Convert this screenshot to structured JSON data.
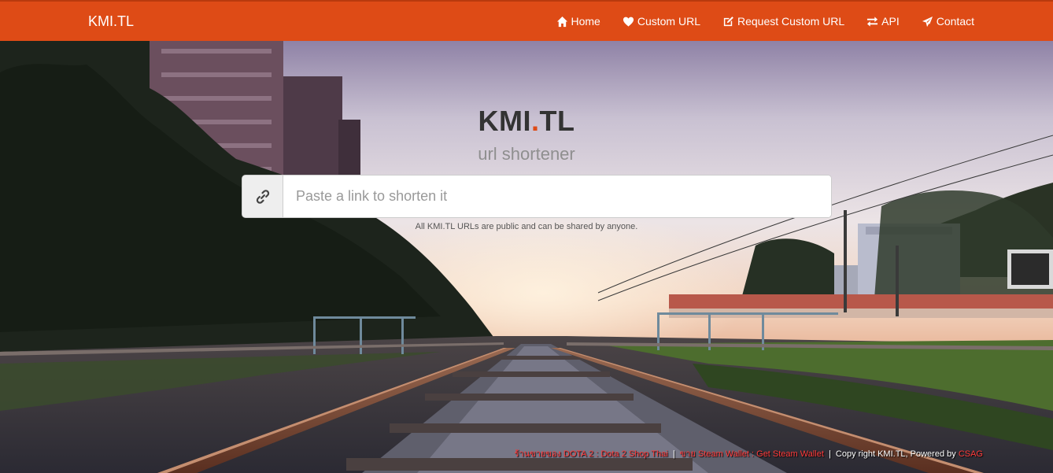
{
  "navbar": {
    "brand": "KMI.TL",
    "items": [
      {
        "label": "Home",
        "icon": "home-icon"
      },
      {
        "label": "Custom URL",
        "icon": "heart-icon"
      },
      {
        "label": "Request Custom URL",
        "icon": "edit-icon"
      },
      {
        "label": "API",
        "icon": "exchange-icon"
      },
      {
        "label": "Contact",
        "icon": "send-icon"
      }
    ]
  },
  "hero": {
    "title_part1": "KMI",
    "title_dot": ".",
    "title_part2": "TL",
    "subtitle": "url shortener",
    "input_placeholder": "Paste a link to shorten it",
    "input_value": "",
    "help_text": "All KMI.TL URLs are public and can be shared by anyone."
  },
  "footer": {
    "link1": "ร้านขายของ DOTA 2 : Dota 2 Shop Thai",
    "sep1": "|",
    "link2": "ขาย Steam Wallet : Get Steam Wallet",
    "sep2": "|",
    "copyright": "Copy right KMI.TL, Powered by",
    "link3": "CSAG"
  },
  "colors": {
    "nav_bg": "#de4b16",
    "accent": "#de4b16",
    "footer_link": "#ff3b3b"
  }
}
